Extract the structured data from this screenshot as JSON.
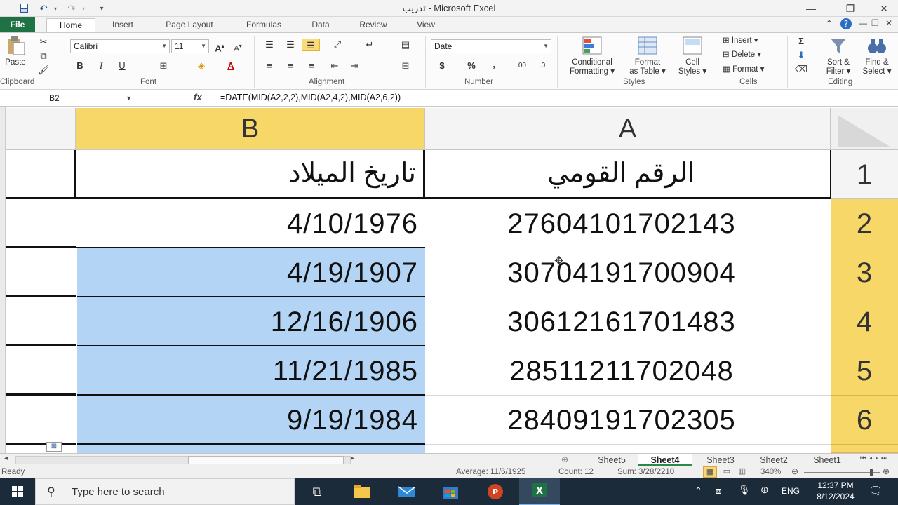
{
  "window": {
    "title": "تدريب - Microsoft Excel",
    "min_glyph": "—",
    "restore_glyph": "❐",
    "close_glyph": "✕"
  },
  "ribbon_tabs": [
    "File",
    "Home",
    "Insert",
    "Page Layout",
    "Formulas",
    "Data",
    "Review",
    "View"
  ],
  "ribbon": {
    "clipboard": {
      "paste": "Paste",
      "group": "Clipboard"
    },
    "font": {
      "name": "Calibri",
      "size": "11",
      "bold": "B",
      "italic": "I",
      "underline": "U",
      "group": "Font"
    },
    "alignment": {
      "group": "Alignment"
    },
    "number": {
      "format": "Date",
      "currency": "$",
      "percent": "%",
      "comma": ",",
      "group": "Number"
    },
    "styles": {
      "conditional": [
        "Conditional",
        "Formatting ▾"
      ],
      "format_table": [
        "Format",
        "as Table ▾"
      ],
      "cell_styles": [
        "Cell",
        "Styles ▾"
      ],
      "group": "Styles"
    },
    "cells": {
      "insert": "Insert ▾",
      "delete": "Delete ▾",
      "format": "Format ▾",
      "group": "Cells"
    },
    "editing": {
      "sigma": "Σ",
      "sort": [
        "Sort &",
        "Filter ▾"
      ],
      "find": [
        "Find &",
        "Select ▾"
      ],
      "group": "Editing"
    }
  },
  "formula_bar": {
    "name_box": "B2",
    "fx": "fx",
    "formula": "=DATE(MID(A2,2,2),MID(A2,4,2),MID(A2,6,2))"
  },
  "sheet": {
    "col_headers": {
      "B": "B",
      "A": "A"
    },
    "rows": [
      {
        "num": "1",
        "a": "الرقم القومي",
        "b": "تاريخ الميلاد"
      },
      {
        "num": "2",
        "a": "27604101702143",
        "b": "4/10/1976"
      },
      {
        "num": "3",
        "a": "30704191700904",
        "b": "4/19/1907"
      },
      {
        "num": "4",
        "a": "30612161701483",
        "b": "12/16/1906"
      },
      {
        "num": "5",
        "a": "28511211702048",
        "b": "11/21/1985"
      },
      {
        "num": "6",
        "a": "28409191702305",
        "b": "9/19/1984"
      }
    ]
  },
  "sheet_tabs": [
    "Sheet5",
    "Sheet4",
    "Sheet3",
    "Sheet2",
    "Sheet1"
  ],
  "status": {
    "ready": "Ready",
    "average": "Average: 11/6/1925",
    "count": "Count: 12",
    "sum": "Sum: 3/28/2210",
    "zoom": "340%"
  },
  "taskbar": {
    "search_placeholder": "Type here to search",
    "lang": "ENG",
    "time": "12:37 PM",
    "date": "8/12/2024"
  },
  "colors": {
    "excel_green": "#1f7244",
    "selected_header": "#f6d768",
    "selection_fill": "#b3d4f5",
    "taskbar": "#1c2b3a"
  }
}
